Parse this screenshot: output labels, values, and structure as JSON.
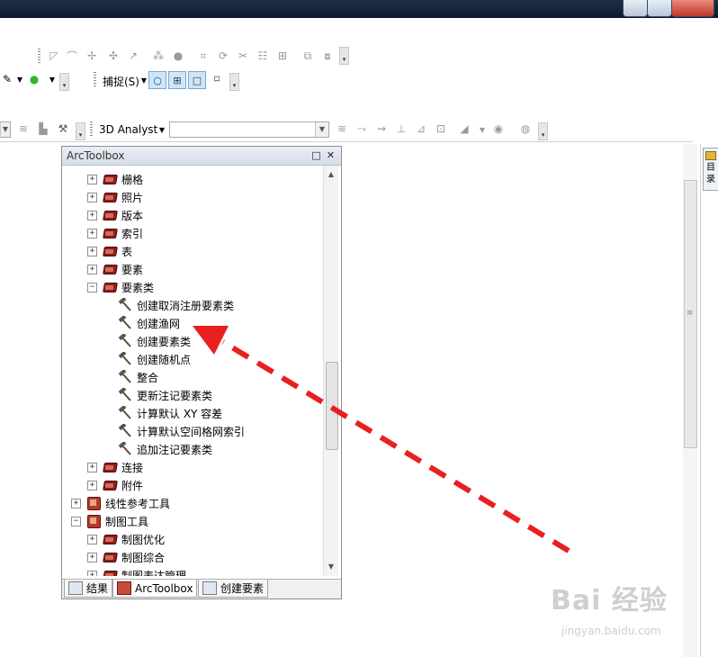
{
  "toolbar": {
    "snap_label": "捕捉(S)",
    "analyst_label": "3D Analyst"
  },
  "panel": {
    "title": "ArcToolbox",
    "float_icon": "restore-icon",
    "close_icon": "close-icon"
  },
  "tree": [
    {
      "label": "栅格",
      "kind": "toolbox",
      "expanded": false
    },
    {
      "label": "照片",
      "kind": "toolbox",
      "expanded": false
    },
    {
      "label": "版本",
      "kind": "toolbox",
      "expanded": false
    },
    {
      "label": "索引",
      "kind": "toolbox",
      "expanded": false
    },
    {
      "label": "表",
      "kind": "toolbox",
      "expanded": false
    },
    {
      "label": "要素",
      "kind": "toolbox",
      "expanded": false
    },
    {
      "label": "要素类",
      "kind": "toolbox",
      "expanded": true
    },
    {
      "label": "创建取消注册要素类",
      "kind": "tool"
    },
    {
      "label": "创建渔网",
      "kind": "tool"
    },
    {
      "label": "创建要素类",
      "kind": "tool"
    },
    {
      "label": "创建随机点",
      "kind": "tool"
    },
    {
      "label": "整合",
      "kind": "tool"
    },
    {
      "label": "更新注记要素类",
      "kind": "tool"
    },
    {
      "label": "计算默认 XY 容差",
      "kind": "tool"
    },
    {
      "label": "计算默认空间格网索引",
      "kind": "tool"
    },
    {
      "label": "追加注记要素类",
      "kind": "tool"
    },
    {
      "label": "连接",
      "kind": "toolbox",
      "expanded": false
    },
    {
      "label": "附件",
      "kind": "toolbox",
      "expanded": false
    },
    {
      "label": "线性参考工具",
      "kind": "cube",
      "expanded": false
    },
    {
      "label": "制图工具",
      "kind": "cube",
      "expanded": true
    },
    {
      "label": "制图优化",
      "kind": "toolbox",
      "expanded": false
    },
    {
      "label": "制图综合",
      "kind": "toolbox",
      "expanded": false
    },
    {
      "label": "制图表达管理",
      "kind": "toolbox",
      "expanded": false
    }
  ],
  "tabs": [
    {
      "label": "结果"
    },
    {
      "label": "ArcToolbox"
    },
    {
      "label": "创建要素"
    }
  ],
  "side_dock": {
    "label": "目录"
  },
  "annotation": {
    "color": "#e8201f"
  },
  "watermark": {
    "brand": "Bai 经验",
    "site": "jingyan.baidu.com"
  }
}
